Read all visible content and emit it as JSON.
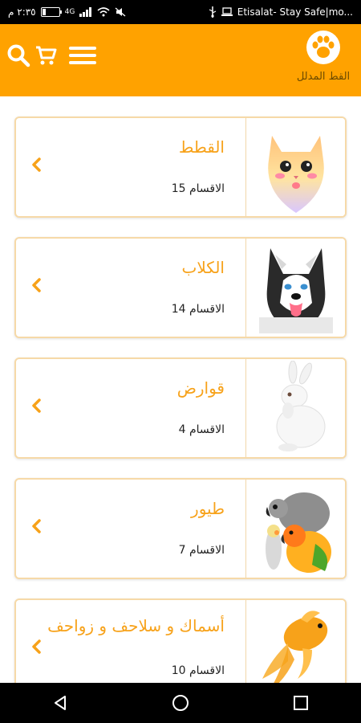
{
  "status_bar": {
    "time": "٢:٣٥ م",
    "battery_text": "0",
    "network_badge": "4G",
    "carrier_text": "Etisalat- Stay Safe|mo..."
  },
  "app_bar": {
    "brand_name": "القط المدلل",
    "icons": [
      "search-icon",
      "cart-icon",
      "menu-icon",
      "paw-icon"
    ]
  },
  "categories": [
    {
      "title": "القطط",
      "sections": "الاقسام 15",
      "image": "cat-image"
    },
    {
      "title": "الكلاب",
      "sections": "الاقسام 14",
      "image": "dog-image"
    },
    {
      "title": "قوارض",
      "sections": "الاقسام 4",
      "image": "rabbit-image"
    },
    {
      "title": "طيور",
      "sections": "الاقسام 7",
      "image": "birds-image"
    },
    {
      "title": "أسماك و سلاحف و زواحف",
      "sections": "الاقسام 10",
      "image": "fish-image"
    }
  ],
  "colors": {
    "accent": "#ffa200",
    "title": "#f7a21a",
    "card_border": "#f6d9a8"
  },
  "nav_bar": {
    "icons": [
      "back-icon",
      "home-icon",
      "recents-icon"
    ]
  }
}
